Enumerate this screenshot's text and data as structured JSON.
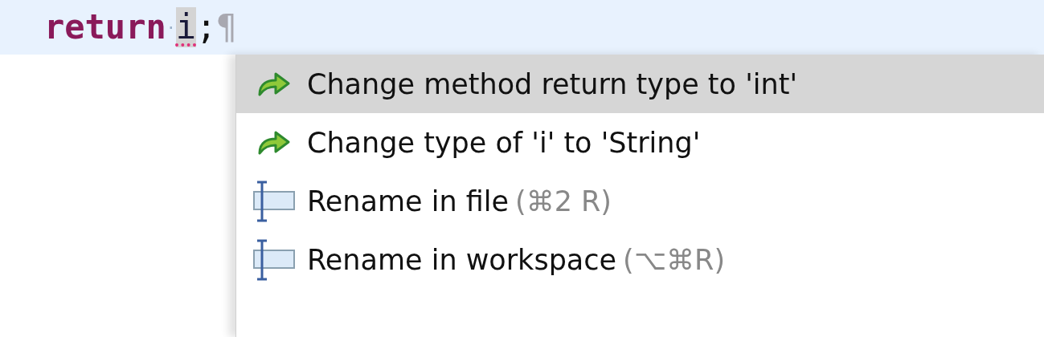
{
  "code_line": {
    "tokens": [
      {
        "kind": "keyword",
        "text": "return"
      },
      {
        "kind": "whitespace",
        "text": "·"
      },
      {
        "kind": "error",
        "text": "i"
      },
      {
        "kind": "plain",
        "text": ";"
      },
      {
        "kind": "marker",
        "text": "¶"
      }
    ]
  },
  "quick_fix_menu": {
    "items": [
      {
        "kind": "change",
        "label": "Change method return type to 'int'",
        "selected": true
      },
      {
        "kind": "change",
        "label": "Change type of 'i' to 'String'",
        "selected": false
      },
      {
        "kind": "rename",
        "label": "Rename in file",
        "shortcut": "(⌘2 R)",
        "selected": false
      },
      {
        "kind": "rename",
        "label": "Rename in workspace",
        "shortcut": "(⌥⌘R)",
        "selected": false
      }
    ]
  }
}
